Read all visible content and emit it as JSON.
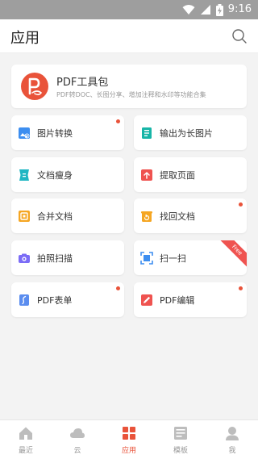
{
  "status_bar": {
    "time": "9:16",
    "icons": [
      "wifi-icon",
      "signal-icon",
      "battery-charging-icon"
    ]
  },
  "header": {
    "title": "应用",
    "search_icon": "search-icon"
  },
  "pdf_toolkit": {
    "title": "PDF工具包",
    "subtitle": "PDF转DOC、长图分享、增加注释和水印等功能合集",
    "icon": "pdf-logo-icon",
    "color": "#e9533a"
  },
  "tools": [
    {
      "label": "图片转换",
      "icon": "image-convert-icon",
      "color": "#3d8ef0",
      "new_dot": true
    },
    {
      "label": "输出为长图片",
      "icon": "long-image-icon",
      "color": "#17b5a7",
      "new_dot": false
    },
    {
      "label": "文档瘦身",
      "icon": "slim-doc-icon",
      "color": "#1fb6c3",
      "new_dot": false
    },
    {
      "label": "提取页面",
      "icon": "extract-page-icon",
      "color": "#ef5350",
      "new_dot": false
    },
    {
      "label": "合并文档",
      "icon": "merge-doc-icon",
      "color": "#f5a623",
      "new_dot": false
    },
    {
      "label": "找回文档",
      "icon": "recover-doc-icon",
      "color": "#f5a623",
      "new_dot": true
    },
    {
      "label": "拍照扫描",
      "icon": "camera-icon",
      "color": "#7b6cf6",
      "new_dot": false
    },
    {
      "label": "扫一扫",
      "icon": "scan-icon",
      "color": "#3d8ef0",
      "new_dot": false,
      "ribbon": "Free"
    },
    {
      "label": "PDF表单",
      "icon": "pdf-form-icon",
      "color": "#5b8def",
      "new_dot": true
    },
    {
      "label": "PDF编辑",
      "icon": "pdf-edit-icon",
      "color": "#ef5350",
      "new_dot": true
    }
  ],
  "tab_bar": [
    {
      "label": "最近",
      "icon": "home-icon",
      "active": false
    },
    {
      "label": "云",
      "icon": "cloud-icon",
      "active": false
    },
    {
      "label": "应用",
      "icon": "apps-grid-icon",
      "active": true
    },
    {
      "label": "模板",
      "icon": "template-icon",
      "active": false
    },
    {
      "label": "我",
      "icon": "profile-icon",
      "active": false
    }
  ],
  "colors": {
    "accent": "#e9533a",
    "inactive": "#bdbdbd",
    "background": "#f3f3f3"
  }
}
